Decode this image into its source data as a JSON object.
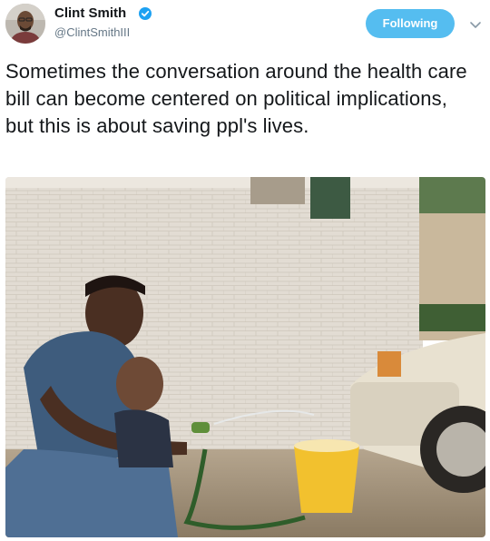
{
  "author": {
    "name": "Clint Smith",
    "handle": "@ClintSmithIII",
    "verified": true,
    "avatar_icon": "profile-avatar",
    "verified_icon": "verified-badge-icon"
  },
  "actions": {
    "follow_label": "Following",
    "menu_icon": "chevron-down-icon"
  },
  "tweet": {
    "text": "Sometimes the conversation around the health care bill can become centered on political implications, but this is about saving ppl's lives."
  },
  "colors": {
    "accent": "#55bdf0",
    "verified": "#1da1f2",
    "handle": "#657786",
    "text": "#14171a"
  }
}
